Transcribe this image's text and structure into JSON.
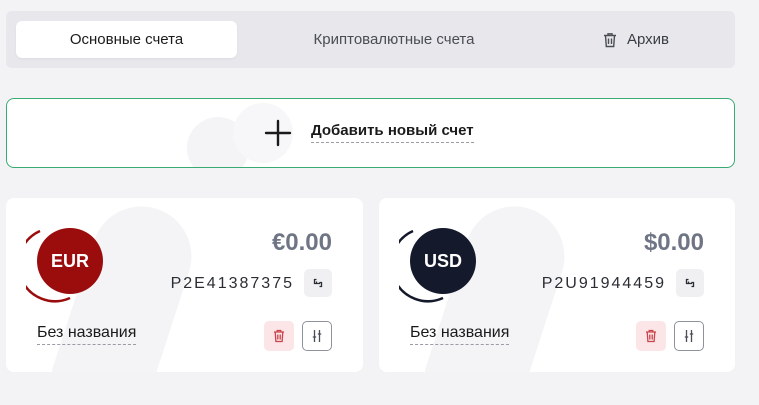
{
  "tabs": [
    {
      "label": "Основные счета",
      "active": true
    },
    {
      "label": "Криптовалютные счета",
      "active": false
    },
    {
      "label": "Архив",
      "active": false,
      "icon": "trash-icon"
    }
  ],
  "add_account": {
    "label": "Добавить новый счет",
    "icon": "plus-icon"
  },
  "accounts": [
    {
      "currency": "EUR",
      "balance": "€0.00",
      "number": "P2E41387375",
      "name": "Без названия",
      "color": "#9b0d0d"
    },
    {
      "currency": "USD",
      "balance": "$0.00",
      "number": "P2U91944459",
      "name": "Без названия",
      "color": "#141a2b"
    }
  ],
  "colors": {
    "accent_green": "#3aaa73",
    "delete_red": "#c9444a",
    "balance_gray": "#6f7585"
  }
}
